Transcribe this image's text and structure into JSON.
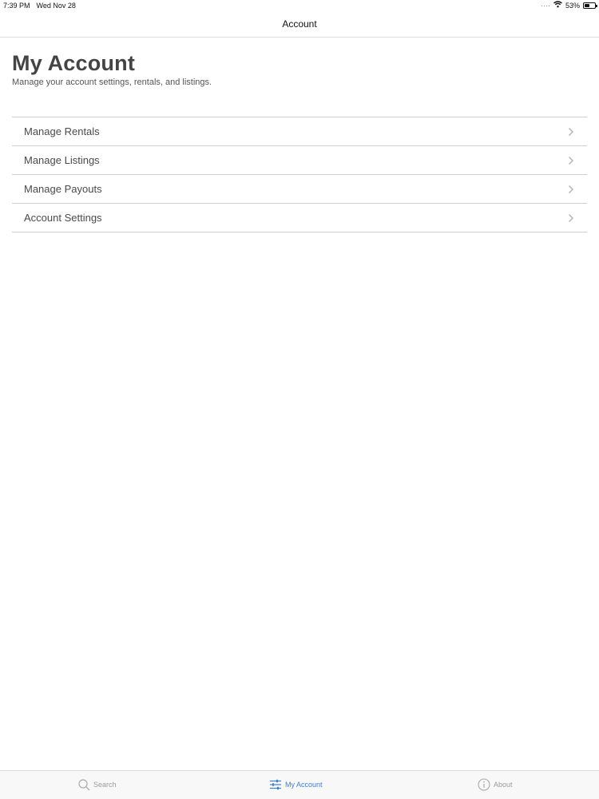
{
  "status_bar": {
    "time": "7:39 PM",
    "date": "Wed Nov 28",
    "battery_percent": "53%",
    "battery_level": 0.53
  },
  "nav": {
    "title": "Account"
  },
  "header": {
    "title": "My Account",
    "subtitle": "Manage your account settings, rentals, and listings."
  },
  "menu": {
    "items": [
      {
        "label": "Manage Rentals"
      },
      {
        "label": "Manage Listings"
      },
      {
        "label": "Manage Payouts"
      },
      {
        "label": "Account Settings"
      }
    ]
  },
  "tabs": {
    "items": [
      {
        "label": "Search",
        "icon": "search-icon"
      },
      {
        "label": "My Account",
        "icon": "sliders-icon",
        "active": true
      },
      {
        "label": "About",
        "icon": "info-icon"
      }
    ]
  },
  "colors": {
    "accent": "#3d7fd6",
    "divider": "#cfcfcf",
    "title": "#444444"
  }
}
